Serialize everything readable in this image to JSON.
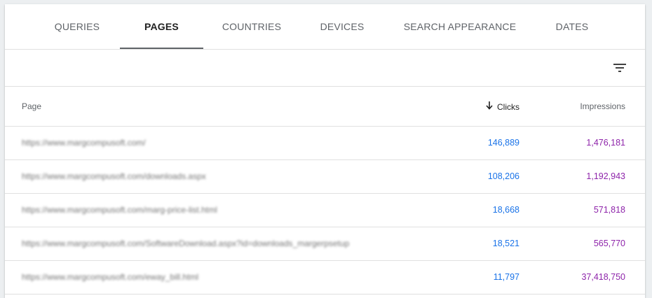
{
  "tabs": [
    {
      "label": "QUERIES"
    },
    {
      "label": "PAGES",
      "active": true
    },
    {
      "label": "COUNTRIES"
    },
    {
      "label": "DEVICES"
    },
    {
      "label": "SEARCH APPEARANCE"
    },
    {
      "label": "DATES"
    }
  ],
  "toolbar": {
    "filter_icon": "filter-list-icon"
  },
  "table": {
    "headers": {
      "page": "Page",
      "clicks": "Clicks",
      "impressions": "Impressions",
      "sort_icon": "arrow-down-icon"
    },
    "rows": [
      {
        "url": "https://www.margcompusoft.com/",
        "clicks": "146,889",
        "impressions": "1,476,181"
      },
      {
        "url": "https://www.margcompusoft.com/downloads.aspx",
        "clicks": "108,206",
        "impressions": "1,192,943"
      },
      {
        "url": "https://www.margcompusoft.com/marg-price-list.html",
        "clicks": "18,668",
        "impressions": "571,818"
      },
      {
        "url": "https://www.margcompusoft.com/SoftwareDownload.aspx?id=downloads_margerpsetup",
        "clicks": "18,521",
        "impressions": "565,770"
      },
      {
        "url": "https://www.margcompusoft.com/eway_bill.html",
        "clicks": "11,797",
        "impressions": "37,418,750"
      }
    ]
  },
  "colors": {
    "clicks": "#1a73e8",
    "impressions": "#8e24aa",
    "active_tab_underline": "#5f6368"
  }
}
